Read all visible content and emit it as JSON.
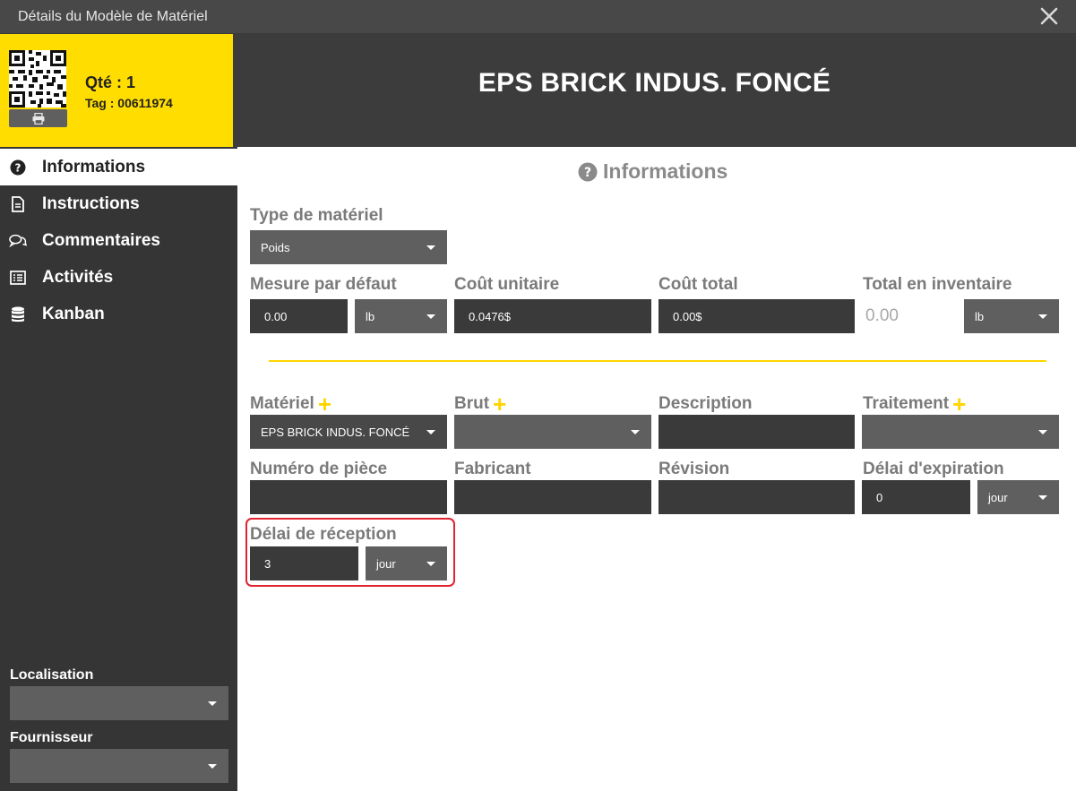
{
  "window": {
    "title": "Détails du Modèle de Matériel",
    "close_icon": "close-icon"
  },
  "tag_panel": {
    "qty": "Qté : 1",
    "tag": "Tag : 00611974",
    "print_icon": "printer-icon",
    "background": "#ffdd00"
  },
  "banner": {
    "title": "EPS BRICK INDUS. FONCÉ",
    "background": "#3c3c3c"
  },
  "sidebar": {
    "items": [
      {
        "label": "Informations",
        "icon": "question-circle-icon",
        "active": true
      },
      {
        "label": "Instructions",
        "icon": "document-icon",
        "active": false
      },
      {
        "label": "Commentaires",
        "icon": "comments-icon",
        "active": false
      },
      {
        "label": "Activités",
        "icon": "list-icon",
        "active": false
      },
      {
        "label": "Kanban",
        "icon": "database-icon",
        "active": false
      }
    ],
    "location_label": "Localisation",
    "location_value": "",
    "supplier_label": "Fournisseur",
    "supplier_value": ""
  },
  "main": {
    "heading": "Informations",
    "heading_icon": "question-circle-icon",
    "material_type": {
      "label": "Type de matériel",
      "value": "Poids"
    },
    "default_measure": {
      "label": "Mesure par défaut",
      "value": "0.00",
      "unit": "lb"
    },
    "unit_cost": {
      "label": "Coût unitaire",
      "value": "0.0476$"
    },
    "total_cost": {
      "label": "Coût total",
      "value": "0.00$"
    },
    "inventory_total": {
      "label": "Total en inventaire",
      "value": "0.00",
      "unit": "lb"
    },
    "material": {
      "label": "Matériel",
      "value": "EPS BRICK INDUS. FONCÉ",
      "plus": "+"
    },
    "raw": {
      "label": "Brut",
      "value": "",
      "plus": "+"
    },
    "description": {
      "label": "Description",
      "value": ""
    },
    "treatment": {
      "label": "Traitement",
      "value": "",
      "plus": "+"
    },
    "part_number": {
      "label": "Numéro de pièce",
      "value": ""
    },
    "manufacturer": {
      "label": "Fabricant",
      "value": ""
    },
    "revision": {
      "label": "Révision",
      "value": ""
    },
    "expiration_delay": {
      "label": "Délai d'expiration",
      "value": "0",
      "unit": "jour"
    },
    "reception_delay": {
      "label": "Délai de réception",
      "value": "3",
      "unit": "jour"
    }
  },
  "colors": {
    "accent": "#ffd500",
    "highlight_border": "#e0232f",
    "sidebar": "#353535",
    "label": "#7a7a7a"
  }
}
